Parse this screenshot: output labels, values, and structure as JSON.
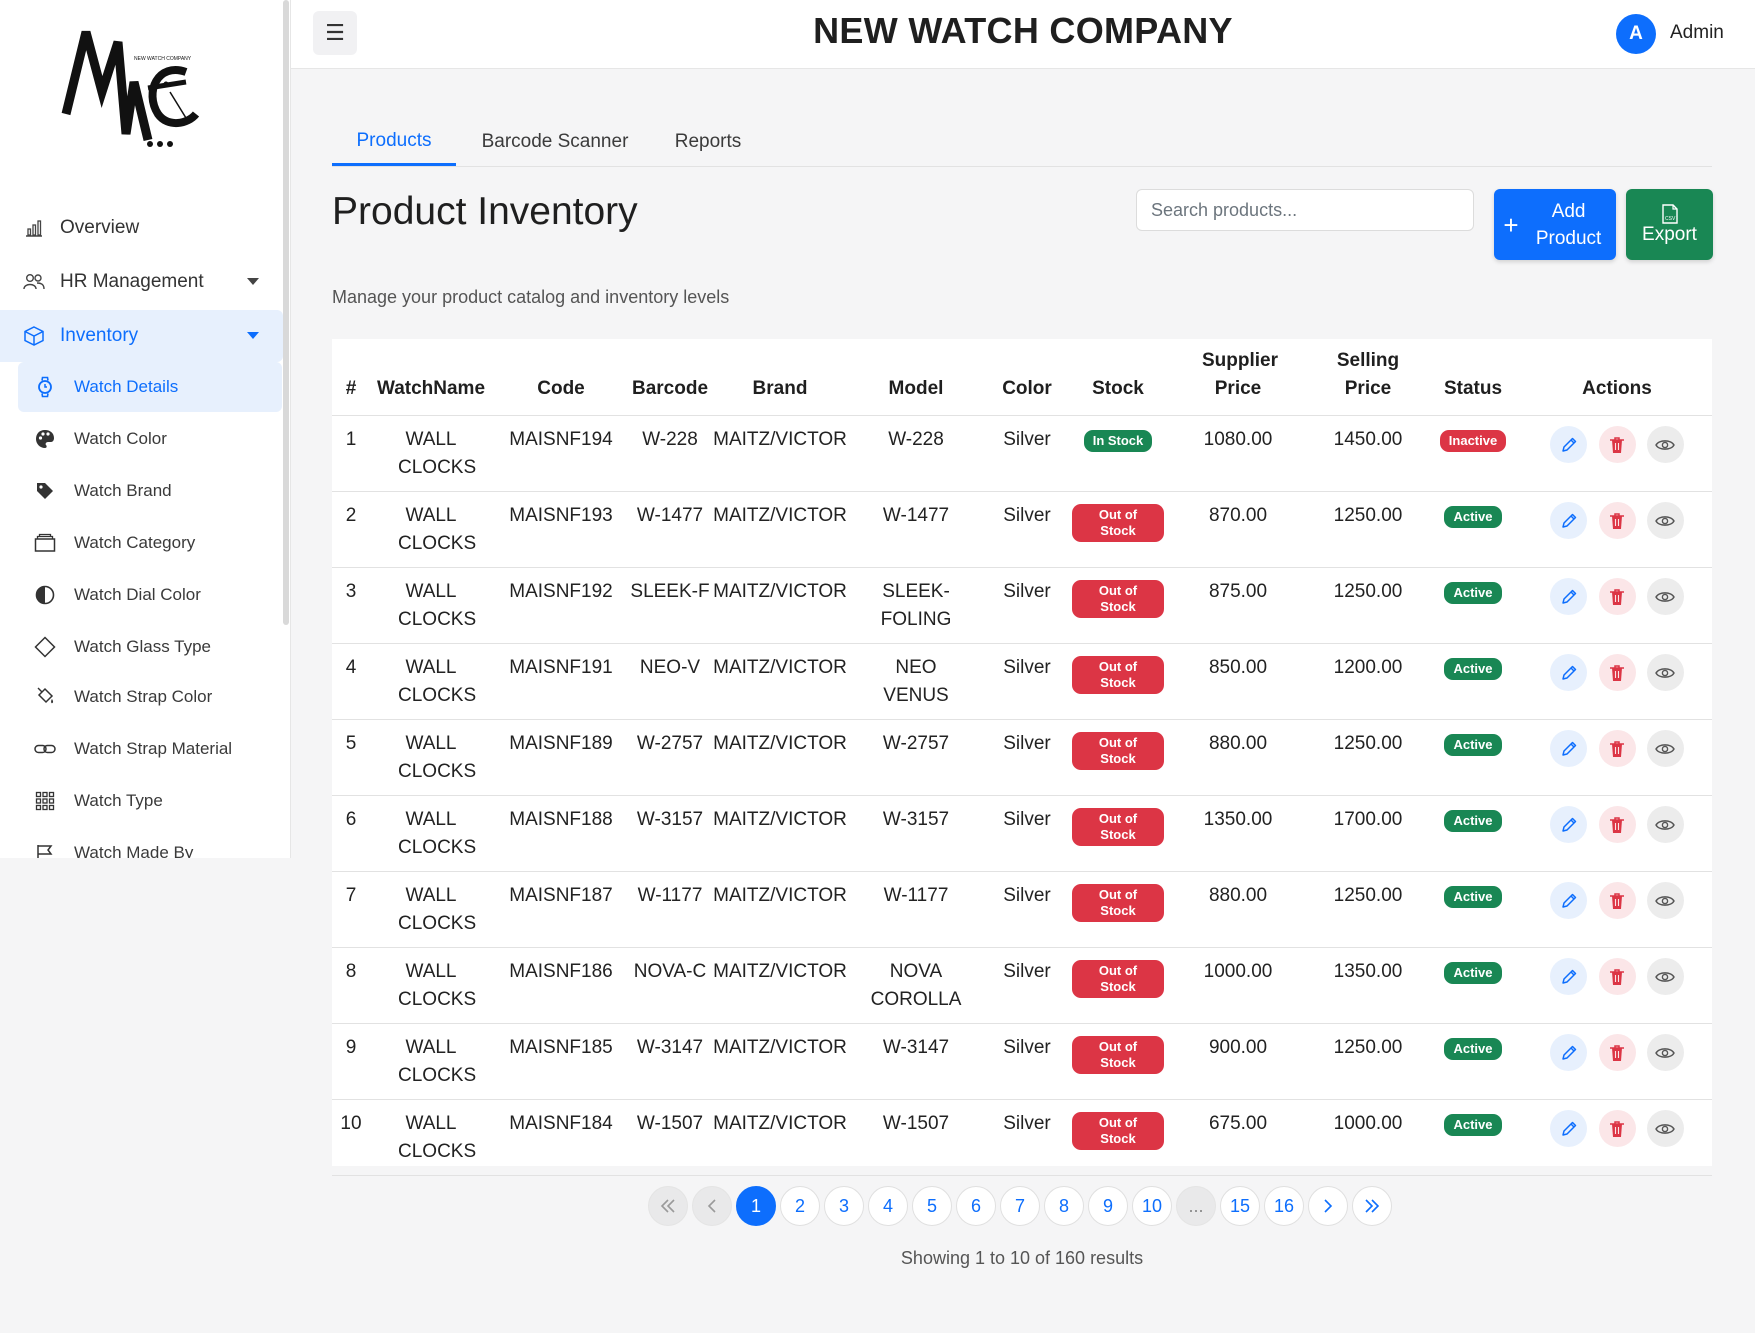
{
  "app": {
    "title": "NEW WATCH COMPANY",
    "user_initial": "A",
    "user_name": "Admin",
    "logo_small_text": "NEW WATCH COMPANY"
  },
  "sidebar": {
    "top_items": [
      {
        "label": "Overview",
        "icon": "bar-chart-icon"
      },
      {
        "label": "HR Management",
        "icon": "people-icon"
      },
      {
        "label": "Inventory",
        "icon": "box-icon"
      }
    ],
    "sub_items": [
      {
        "label": "Watch Details",
        "icon": "watch-icon"
      },
      {
        "label": "Watch Color",
        "icon": "palette-icon"
      },
      {
        "label": "Watch Brand",
        "icon": "tag-icon"
      },
      {
        "label": "Watch Category",
        "icon": "folder-icon"
      },
      {
        "label": "Watch Dial Color",
        "icon": "half-circle-icon"
      },
      {
        "label": "Watch Glass Type",
        "icon": "diamond-icon"
      },
      {
        "label": "Watch Strap Color",
        "icon": "paint-bucket-icon"
      },
      {
        "label": "Watch Strap Material",
        "icon": "link-icon"
      },
      {
        "label": "Watch Type",
        "icon": "grid-icon"
      },
      {
        "label": "Watch Made By",
        "icon": "flag-icon"
      }
    ]
  },
  "tabs": [
    {
      "label": "Products",
      "active": true
    },
    {
      "label": "Barcode Scanner",
      "active": false
    },
    {
      "label": "Reports",
      "active": false
    }
  ],
  "page": {
    "title": "Product Inventory",
    "subtitle": "Manage your product catalog and inventory levels",
    "search_placeholder": "Search products...",
    "add_label": "Add Product",
    "export_label": "Export"
  },
  "table": {
    "headers": {
      "num": "#",
      "name": "WatchName",
      "code": "Code",
      "barcode": "Barcode",
      "brand": "Brand",
      "model": "Model",
      "color": "Color",
      "stock": "Stock",
      "supplier": "Supplier Price",
      "selling": "Selling Price",
      "status": "Status",
      "actions": "Actions"
    },
    "rows": [
      {
        "num": "1",
        "name": "WALL CLOCKS",
        "code": "MAISNF194",
        "barcode": "W-228",
        "brand": "MAITZ/VICTOR",
        "model": "W-228",
        "color": "Silver",
        "stock": "In Stock",
        "supplier": "1080.00",
        "selling": "1450.00",
        "status": "Inactive"
      },
      {
        "num": "2",
        "name": "WALL CLOCKS",
        "code": "MAISNF193",
        "barcode": "W-1477",
        "brand": "MAITZ/VICTOR",
        "model": "W-1477",
        "color": "Silver",
        "stock": "Out of Stock",
        "supplier": "870.00",
        "selling": "1250.00",
        "status": "Active"
      },
      {
        "num": "3",
        "name": "WALL CLOCKS",
        "code": "MAISNF192",
        "barcode": "SLEEK-F",
        "brand": "MAITZ/VICTOR",
        "model": "SLEEK-FOLING",
        "color": "Silver",
        "stock": "Out of Stock",
        "supplier": "875.00",
        "selling": "1250.00",
        "status": "Active"
      },
      {
        "num": "4",
        "name": "WALL CLOCKS",
        "code": "MAISNF191",
        "barcode": "NEO-V",
        "brand": "MAITZ/VICTOR",
        "model": "NEO VENUS",
        "color": "Silver",
        "stock": "Out of Stock",
        "supplier": "850.00",
        "selling": "1200.00",
        "status": "Active"
      },
      {
        "num": "5",
        "name": "WALL CLOCKS",
        "code": "MAISNF189",
        "barcode": "W-2757",
        "brand": "MAITZ/VICTOR",
        "model": "W-2757",
        "color": "Silver",
        "stock": "Out of Stock",
        "supplier": "880.00",
        "selling": "1250.00",
        "status": "Active"
      },
      {
        "num": "6",
        "name": "WALL CLOCKS",
        "code": "MAISNF188",
        "barcode": "W-3157",
        "brand": "MAITZ/VICTOR",
        "model": "W-3157",
        "color": "Silver",
        "stock": "Out of Stock",
        "supplier": "1350.00",
        "selling": "1700.00",
        "status": "Active"
      },
      {
        "num": "7",
        "name": "WALL CLOCKS",
        "code": "MAISNF187",
        "barcode": "W-1177",
        "brand": "MAITZ/VICTOR",
        "model": "W-1177",
        "color": "Silver",
        "stock": "Out of Stock",
        "supplier": "880.00",
        "selling": "1250.00",
        "status": "Active"
      },
      {
        "num": "8",
        "name": "WALL CLOCKS",
        "code": "MAISNF186",
        "barcode": "NOVA-C",
        "brand": "MAITZ/VICTOR",
        "model": "NOVA COROLLA",
        "color": "Silver",
        "stock": "Out of Stock",
        "supplier": "1000.00",
        "selling": "1350.00",
        "status": "Active"
      },
      {
        "num": "9",
        "name": "WALL CLOCKS",
        "code": "MAISNF185",
        "barcode": "W-3147",
        "brand": "MAITZ/VICTOR",
        "model": "W-3147",
        "color": "Silver",
        "stock": "Out of Stock",
        "supplier": "900.00",
        "selling": "1250.00",
        "status": "Active"
      },
      {
        "num": "10",
        "name": "WALL CLOCKS",
        "code": "MAISNF184",
        "barcode": "W-1507",
        "brand": "MAITZ/VICTOR",
        "model": "W-1507",
        "color": "Silver",
        "stock": "Out of Stock",
        "supplier": "675.00",
        "selling": "1000.00",
        "status": "Active"
      }
    ]
  },
  "pagination": {
    "pages": [
      "1",
      "2",
      "3",
      "4",
      "5",
      "6",
      "7",
      "8",
      "9",
      "10",
      "...",
      "15",
      "16"
    ],
    "current": "1",
    "results_text": "Showing 1 to 10 of 160 results"
  },
  "colors": {
    "primary": "#0d6efd",
    "success": "#198754",
    "danger": "#dc3545"
  }
}
